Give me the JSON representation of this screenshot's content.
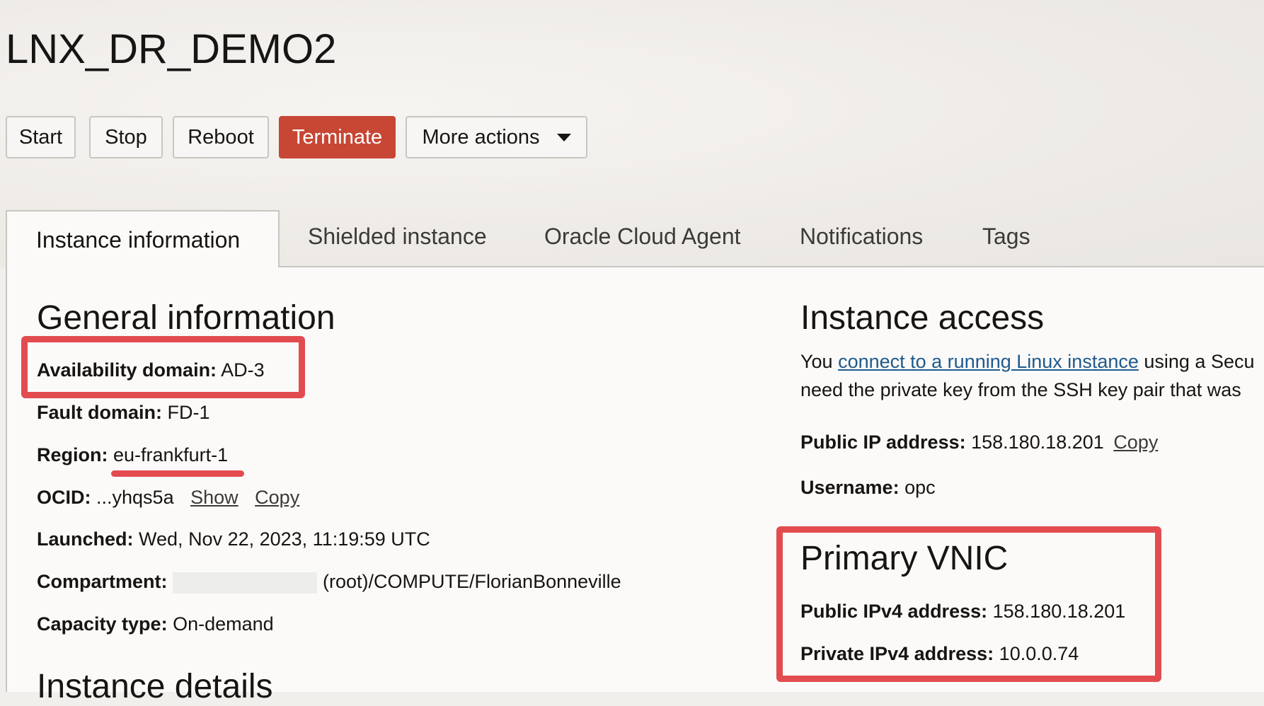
{
  "page": {
    "title": "LNX_DR_DEMO2"
  },
  "actions": {
    "start": "Start",
    "stop": "Stop",
    "reboot": "Reboot",
    "terminate": "Terminate",
    "more_actions": "More actions"
  },
  "tabs": [
    {
      "label": "Instance information",
      "active": true
    },
    {
      "label": "Shielded instance"
    },
    {
      "label": "Oracle Cloud Agent"
    },
    {
      "label": "Notifications"
    },
    {
      "label": "Tags"
    }
  ],
  "general": {
    "heading": "General information",
    "availability_domain": {
      "label": "Availability domain:",
      "value": "AD-3"
    },
    "fault_domain": {
      "label": "Fault domain:",
      "value": "FD-1"
    },
    "region": {
      "label": "Region:",
      "value": "eu-frankfurt-1"
    },
    "ocid": {
      "label": "OCID:",
      "value": "...yhqs5a",
      "show": "Show",
      "copy": "Copy"
    },
    "launched": {
      "label": "Launched:",
      "value": "Wed, Nov 22, 2023, 11:19:59 UTC"
    },
    "compartment": {
      "label": "Compartment:",
      "value": "(root)/COMPUTE/FlorianBonneville"
    },
    "capacity_type": {
      "label": "Capacity type:",
      "value": "On-demand"
    },
    "next_heading_partial": "Instance details"
  },
  "access": {
    "heading": "Instance access",
    "line1_prefix": "You ",
    "line1_link": "connect to a running Linux instance",
    "line1_suffix": " using a Secu",
    "line2": "need the private key from the SSH key pair that was",
    "public_ip": {
      "label": "Public IP address:",
      "value": "158.180.18.201",
      "copy": "Copy"
    },
    "username": {
      "label": "Username:",
      "value": "opc"
    }
  },
  "vnic": {
    "heading": "Primary VNIC",
    "public_ipv4": {
      "label": "Public IPv4 address:",
      "value": "158.180.18.201"
    },
    "private_ipv4": {
      "label": "Private IPv4 address:",
      "value": "10.0.0.74"
    }
  },
  "colors": {
    "terminate": "#c74634",
    "highlight": "#e24c4f",
    "link": "#1f5a8c"
  }
}
